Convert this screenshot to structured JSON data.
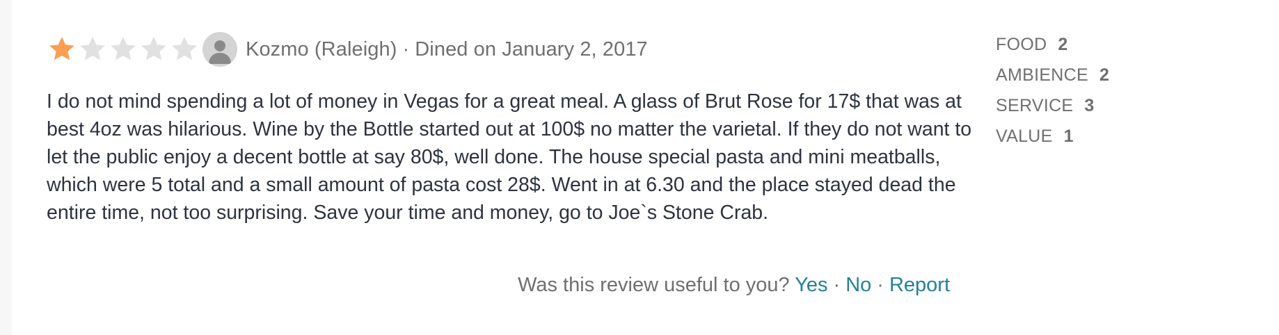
{
  "review": {
    "rating": 1,
    "rating_max": 5,
    "colors": {
      "star_filled": "#f9a054",
      "star_empty": "#e1e1e1",
      "link": "#247f9e",
      "text": "#2d333f",
      "muted": "#6f6f6f"
    },
    "reviewer": "Kozmo (Raleigh)",
    "separator": "·",
    "dined_text": "Dined on January 2, 2017",
    "body": "I do not mind spending a lot of money in Vegas for a great meal. A glass of Brut Rose for 17$ that was at best 4oz was hilarious. Wine by the Bottle started out at 100$ no matter the varietal. If they do not want to let the public enjoy a decent bottle at say 80$, well done. The house special pasta and mini meatballs, which were 5 total and a small amount of pasta cost 28$. Went in at 6.30 and the place stayed dead the entire time, not too surprising. Save your time and money, go to Joe`s Stone Crab.",
    "feedback": {
      "question": "Was this review useful to you?",
      "yes_label": "Yes",
      "no_label": "No",
      "report_label": "Report",
      "separator": "·"
    },
    "sub_ratings": [
      {
        "label": "FOOD",
        "value": "2"
      },
      {
        "label": "AMBIENCE",
        "value": "2"
      },
      {
        "label": "SERVICE",
        "value": "3"
      },
      {
        "label": "VALUE",
        "value": "1"
      }
    ]
  }
}
